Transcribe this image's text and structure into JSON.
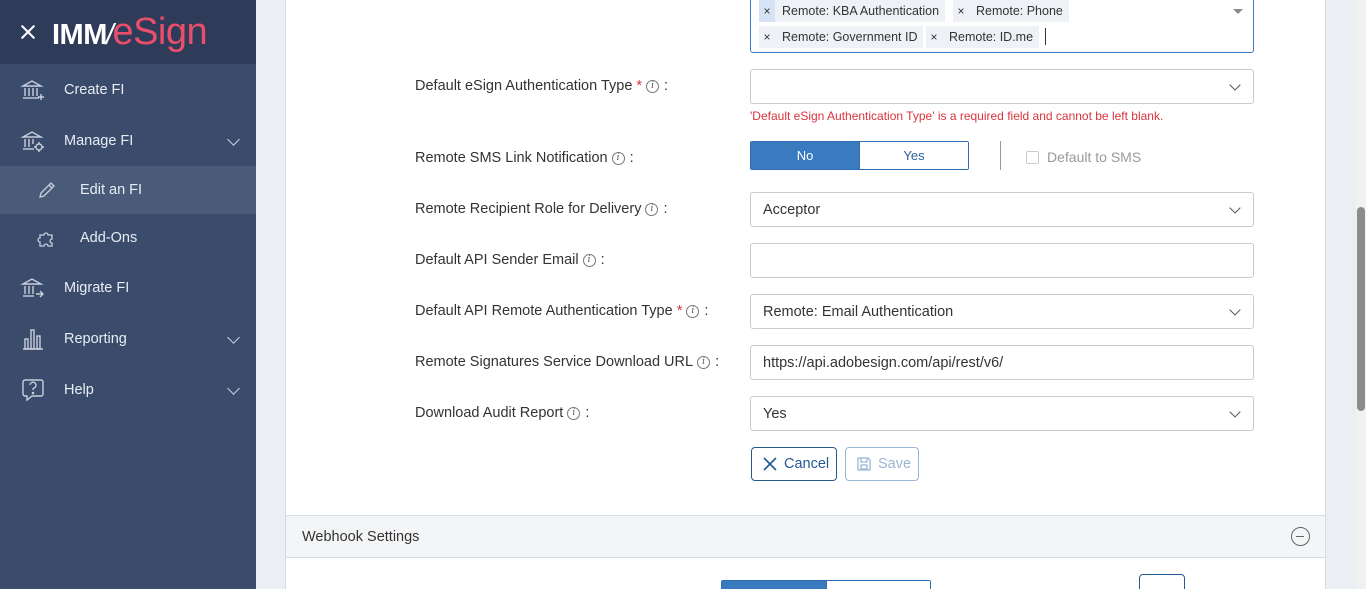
{
  "sidebar": {
    "logo_part1": "IMM",
    "logo_slash": "/",
    "logo_part2": "eSign",
    "items": {
      "create": "Create FI",
      "manage": "Manage FI",
      "edit": "Edit an FI",
      "addons": "Add-Ons",
      "migrate": "Migrate FI",
      "reporting": "Reporting",
      "help": "Help"
    }
  },
  "form": {
    "auth_tags": [
      "Remote: KBA Authentication",
      "Remote: Phone",
      "Remote: Government ID",
      "Remote: ID.me"
    ],
    "tag_remove_glyph": "×",
    "default_esign_auth": {
      "label": "Default eSign Authentication Type",
      "value": "",
      "error": "'Default eSign Authentication Type' is a required field and cannot be left blank."
    },
    "sms_link": {
      "label": "Remote SMS Link Notification",
      "options": [
        "No",
        "Yes"
      ],
      "selected": "No",
      "default_to_sms_label": "Default to SMS"
    },
    "recipient_role": {
      "label": "Remote Recipient Role for Delivery",
      "value": "Acceptor"
    },
    "api_sender_email": {
      "label": "Default API Sender Email",
      "value": ""
    },
    "api_remote_auth": {
      "label": "Default API Remote Authentication Type",
      "value": "Remote: Email Authentication"
    },
    "download_url": {
      "label": "Remote Signatures Service Download URL",
      "value": "https://api.adobesign.com/api/rest/v6/"
    },
    "audit_report": {
      "label": "Download Audit Report",
      "value": "Yes"
    },
    "required_mark": "*",
    "info_glyph": "i",
    "colon": ":",
    "cancel_label": "Cancel",
    "save_label": "Save"
  },
  "webhook": {
    "title": "Webhook Settings"
  },
  "colors": {
    "sidebar_bg": "#3b4b6b",
    "sidebar_header_bg": "#2e3c59",
    "logo_accent": "#e94f6b",
    "primary": "#3a7abf",
    "error": "#d9343d"
  }
}
